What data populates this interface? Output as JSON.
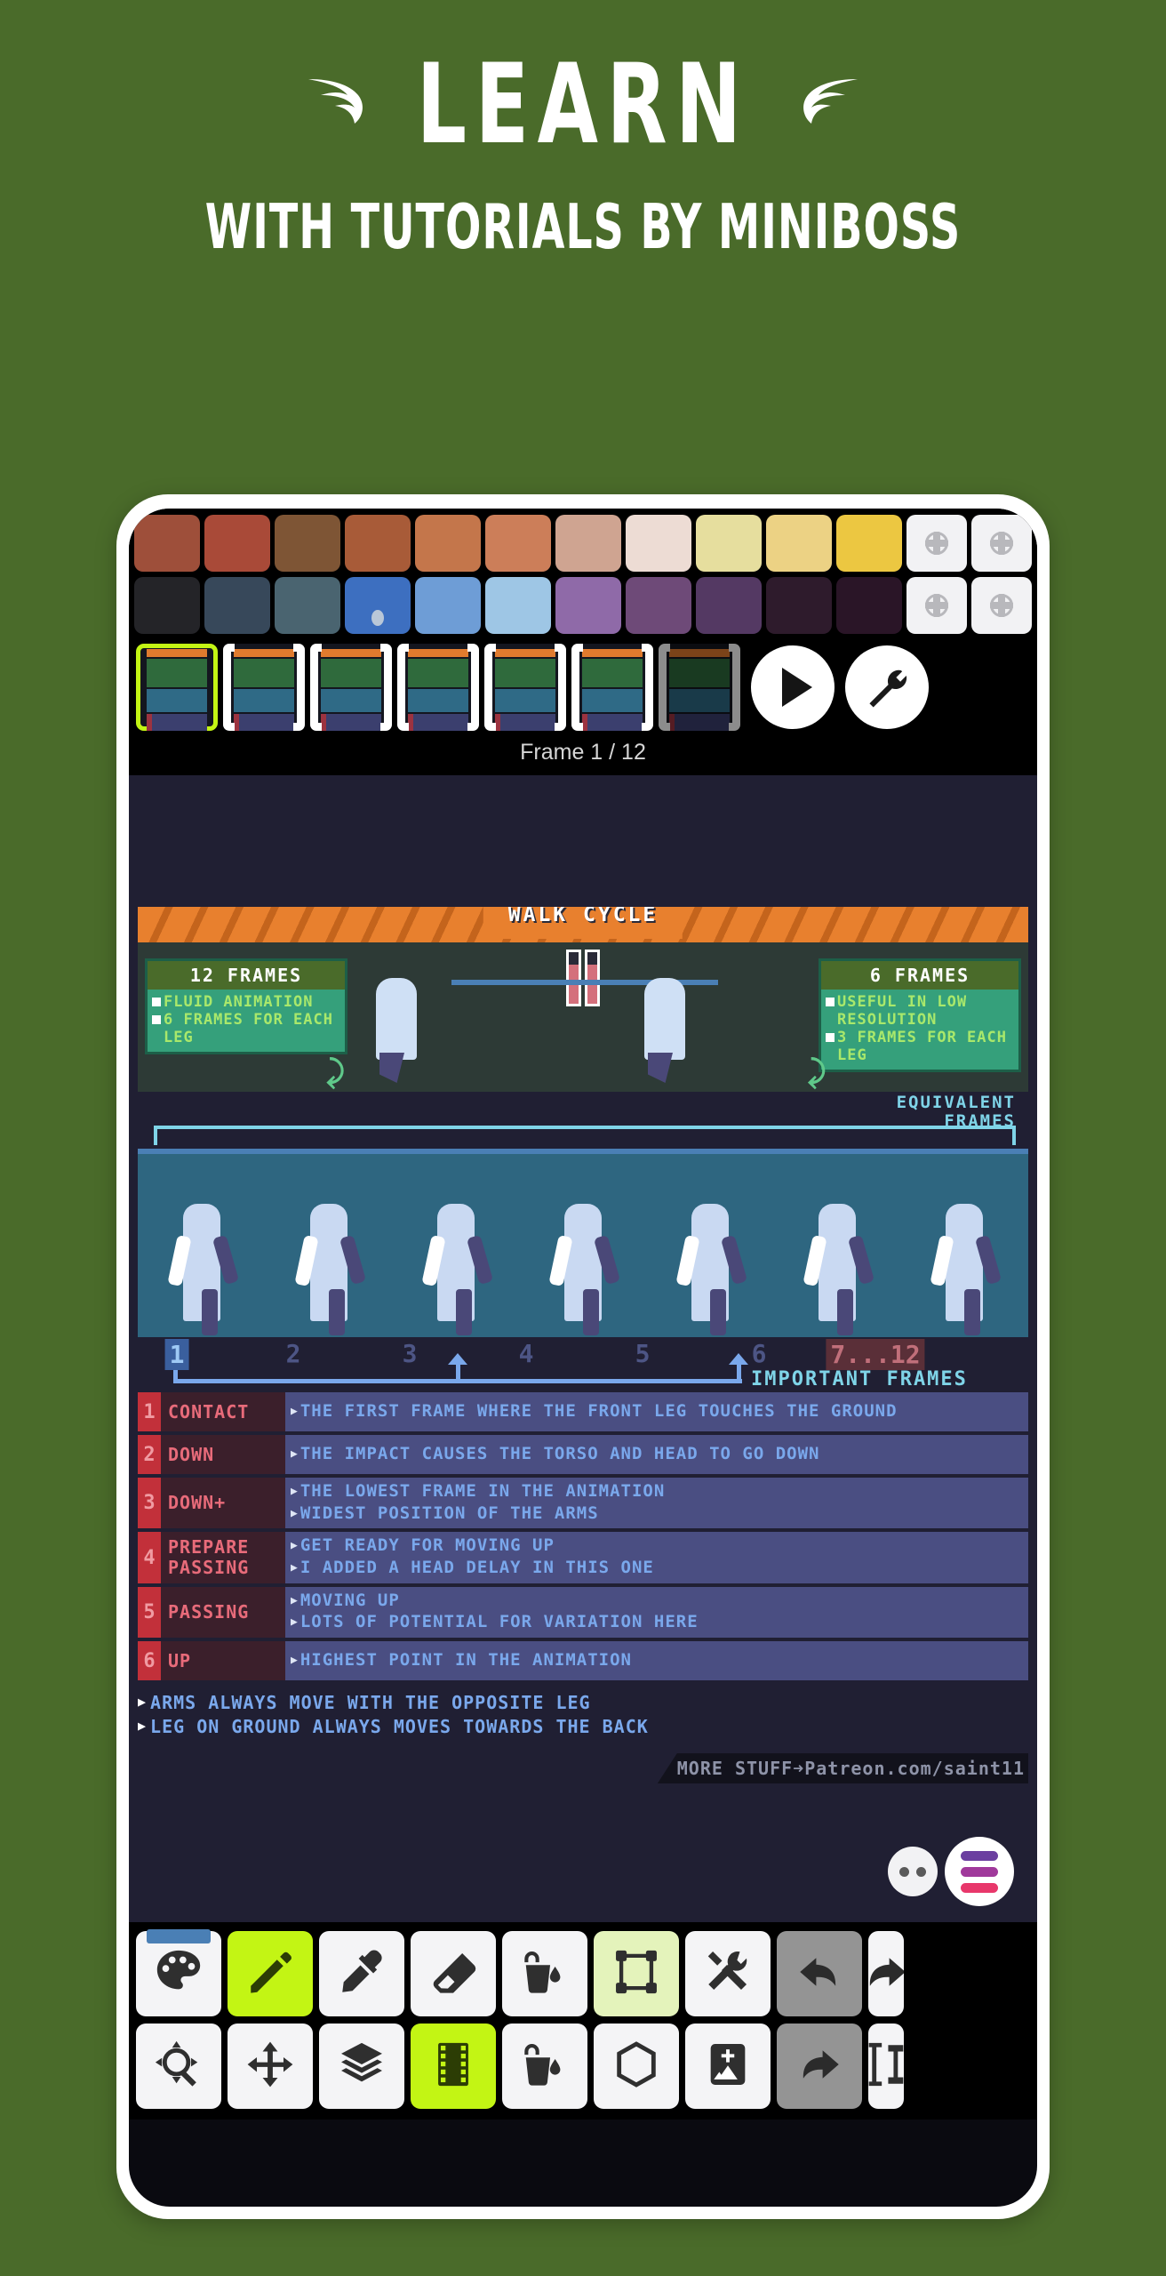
{
  "header": {
    "title": "LEARN",
    "subtitle": "WITH TUTORIALS BY MINIBOSS",
    "left_wing_icon": "wing-icon",
    "right_wing_icon": "wing-icon"
  },
  "palette": {
    "row1": [
      "#9e4f3a",
      "#a94a38",
      "#7e5535",
      "#a85b38",
      "#c4764b",
      "#cc7e59",
      "#cfa491",
      "#eddcd4",
      "#e6de9e",
      "#ecd284",
      "#ecc741"
    ],
    "row2": [
      "#242428",
      "#37485a",
      "#4a6470",
      "#3d6fc0",
      "#6e9dd6",
      "#9ec6e5",
      "#8f6aa8",
      "#6e4a78",
      "#543963",
      "#2e1b2c",
      "#2a1527"
    ],
    "add_icon": "add-color-icon",
    "selected_index": 3
  },
  "frames": {
    "count": 7,
    "active_index": 0,
    "label": "Frame 1 / 12",
    "play_icon": "play-icon",
    "settings_icon": "wrench-icon"
  },
  "canvas": {
    "banner_title": "WALK CYCLE",
    "info_left": {
      "title": "12 FRAMES",
      "lines": [
        "FLUID ANIMATION",
        "6 FRAMES FOR EACH LEG"
      ]
    },
    "info_right": {
      "title": "6 FRAMES",
      "lines": [
        "USEFUL IN LOW RESOLUTION",
        "3 FRAMES FOR EACH LEG"
      ]
    },
    "equivalent_label_line1": "EQUIVALENT",
    "equivalent_label_line2": "FRAMES",
    "frame_numbers": [
      "1",
      "2",
      "3",
      "4",
      "5",
      "6",
      "7...12"
    ],
    "important_frames_label": "IMPORTANT FRAMES",
    "table": [
      {
        "num": "1",
        "name": "CONTACT",
        "desc": [
          "THE FIRST FRAME WHERE THE FRONT LEG TOUCHES THE GROUND"
        ]
      },
      {
        "num": "2",
        "name": "DOWN",
        "desc": [
          "THE IMPACT CAUSES THE TORSO AND HEAD TO GO DOWN"
        ]
      },
      {
        "num": "3",
        "name": "DOWN+",
        "desc": [
          "THE LOWEST FRAME IN THE ANIMATION",
          "WIDEST POSITION OF THE ARMS"
        ]
      },
      {
        "num": "4",
        "name": "PREPARE PASSING",
        "desc": [
          "GET READY FOR MOVING UP",
          "I ADDED A HEAD DELAY IN THIS ONE"
        ]
      },
      {
        "num": "5",
        "name": "PASSING",
        "desc": [
          "MOVING UP",
          "LOTS OF POTENTIAL FOR VARIATION HERE"
        ]
      },
      {
        "num": "6",
        "name": "UP",
        "desc": [
          "HIGHEST POINT IN THE ANIMATION"
        ]
      }
    ],
    "notes": [
      "ARMS ALWAYS MOVE WITH THE OPPOSITE LEG",
      "LEG ON GROUND ALWAYS MOVES TOWARDS THE BACK"
    ],
    "credit": "MORE STUFF➜Patreon.com/saint11"
  },
  "floating": {
    "more_icon": "two-dots-icon",
    "menu_icon": "hamburger-menu-icon",
    "menu_colors": [
      "#6b3fa0",
      "#a0399b",
      "#e8376b"
    ]
  },
  "toolbar": {
    "row1": [
      {
        "name": "palette-tool",
        "icon": "palette-icon",
        "state": "normal"
      },
      {
        "name": "pencil-tool",
        "icon": "pencil-icon",
        "state": "active"
      },
      {
        "name": "eyedropper-tool",
        "icon": "eyedropper-icon",
        "state": "normal"
      },
      {
        "name": "eraser-tool",
        "icon": "eraser-icon",
        "state": "normal"
      },
      {
        "name": "bucket-fill-tool",
        "icon": "paint-bucket-icon",
        "state": "normal"
      },
      {
        "name": "select-transform-tool",
        "icon": "selection-frame-icon",
        "state": "soft"
      },
      {
        "name": "tools-tool",
        "icon": "tools-icon",
        "state": "normal"
      },
      {
        "name": "undo-button",
        "icon": "undo-arrow-icon",
        "state": "gray"
      },
      {
        "name": "redo-button-partial",
        "icon": "redo-arrow-icon",
        "state": "normal"
      }
    ],
    "row2": [
      {
        "name": "zoom-tool",
        "icon": "magnifier-icon",
        "state": "normal"
      },
      {
        "name": "move-tool",
        "icon": "move-arrows-icon",
        "state": "normal"
      },
      {
        "name": "layers-tool",
        "icon": "layers-icon",
        "state": "normal"
      },
      {
        "name": "animation-tool",
        "icon": "film-strip-icon",
        "state": "active"
      },
      {
        "name": "fill-all-tool",
        "icon": "paint-bucket-fill-icon",
        "state": "normal"
      },
      {
        "name": "shape-tool",
        "icon": "hexagon-icon",
        "state": "normal"
      },
      {
        "name": "add-image-tool",
        "icon": "add-image-icon",
        "state": "normal"
      },
      {
        "name": "redo-button",
        "icon": "redo-arrow-icon",
        "state": "gray"
      },
      {
        "name": "resize-tool-partial",
        "icon": "resize-icon",
        "state": "normal"
      }
    ]
  }
}
